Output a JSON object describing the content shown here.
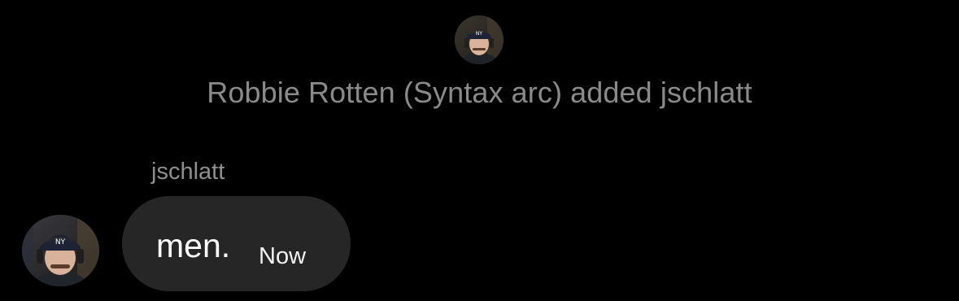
{
  "system_event": {
    "text": "Robbie Rotten (Syntax arc) added jschlatt",
    "avatar_icon": "user-avatar-photo"
  },
  "message": {
    "sender": "jschlatt",
    "text": "men.",
    "timestamp": "Now",
    "avatar_icon": "user-avatar-photo"
  },
  "colors": {
    "background": "#000000",
    "bubble": "#262626",
    "system_text": "#8a8a8a",
    "sender_name": "#8e8e8e",
    "message_text": "#ffffff"
  }
}
